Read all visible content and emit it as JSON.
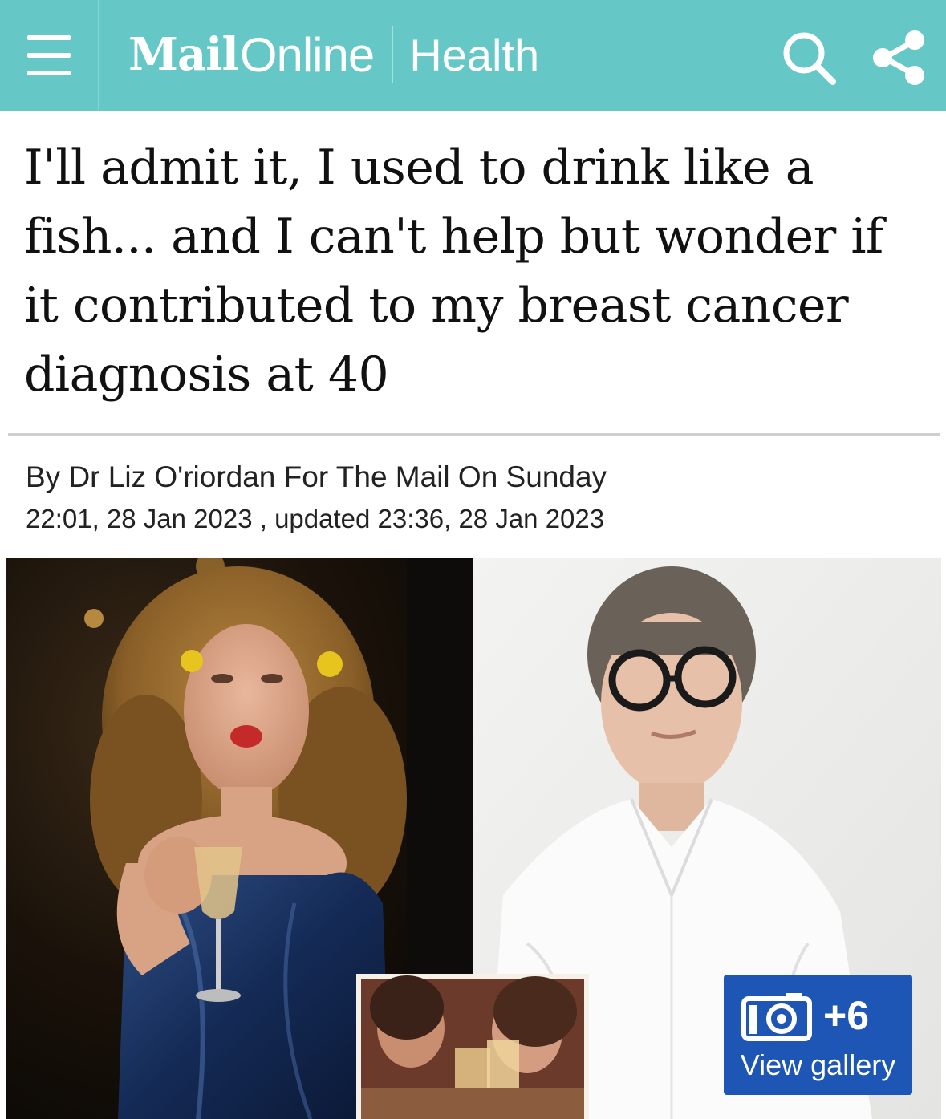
{
  "header": {
    "brand_mail": "Mail",
    "brand_online": "Online",
    "section": "Health",
    "background_color": "#66c7c7",
    "icons": [
      "menu-icon",
      "search-icon",
      "share-icon"
    ]
  },
  "article": {
    "headline": "I'll admit it, I used to drink like a fish... and I can't help but wonder if it contributed to my breast cancer diagnosis at 40",
    "byline": "By Dr Liz O'riordan For The Mail On Sunday",
    "dateline": "22:01, 28 Jan 2023 , updated 23:36, 28 Jan 2023"
  },
  "gallery": {
    "count": "+6",
    "label": "View gallery",
    "button_color": "#1d56b5"
  }
}
